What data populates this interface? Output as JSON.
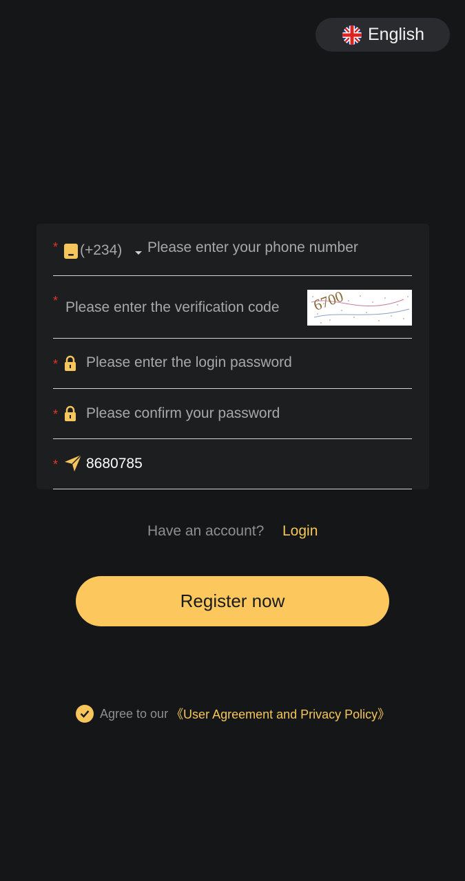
{
  "language": {
    "label": "English",
    "icon": "uk-flag-icon"
  },
  "form": {
    "phone": {
      "country_code": "(+234)",
      "placeholder": "Please enter your phone number"
    },
    "verification": {
      "placeholder": "Please enter the verification code",
      "captcha_text": "6700"
    },
    "password": {
      "placeholder": "Please enter the login password"
    },
    "confirm_password": {
      "placeholder": "Please confirm your password"
    },
    "invite": {
      "value": "8680785"
    },
    "required_mark": "*"
  },
  "account": {
    "prompt": "Have an account?",
    "login_label": "Login"
  },
  "register_button": "Register now",
  "agreement": {
    "prefix": "Agree to our",
    "link": "《User Agreement and Privacy Policy》"
  },
  "colors": {
    "accent": "#fcc85e",
    "background": "#151618",
    "required": "#e5352b"
  }
}
